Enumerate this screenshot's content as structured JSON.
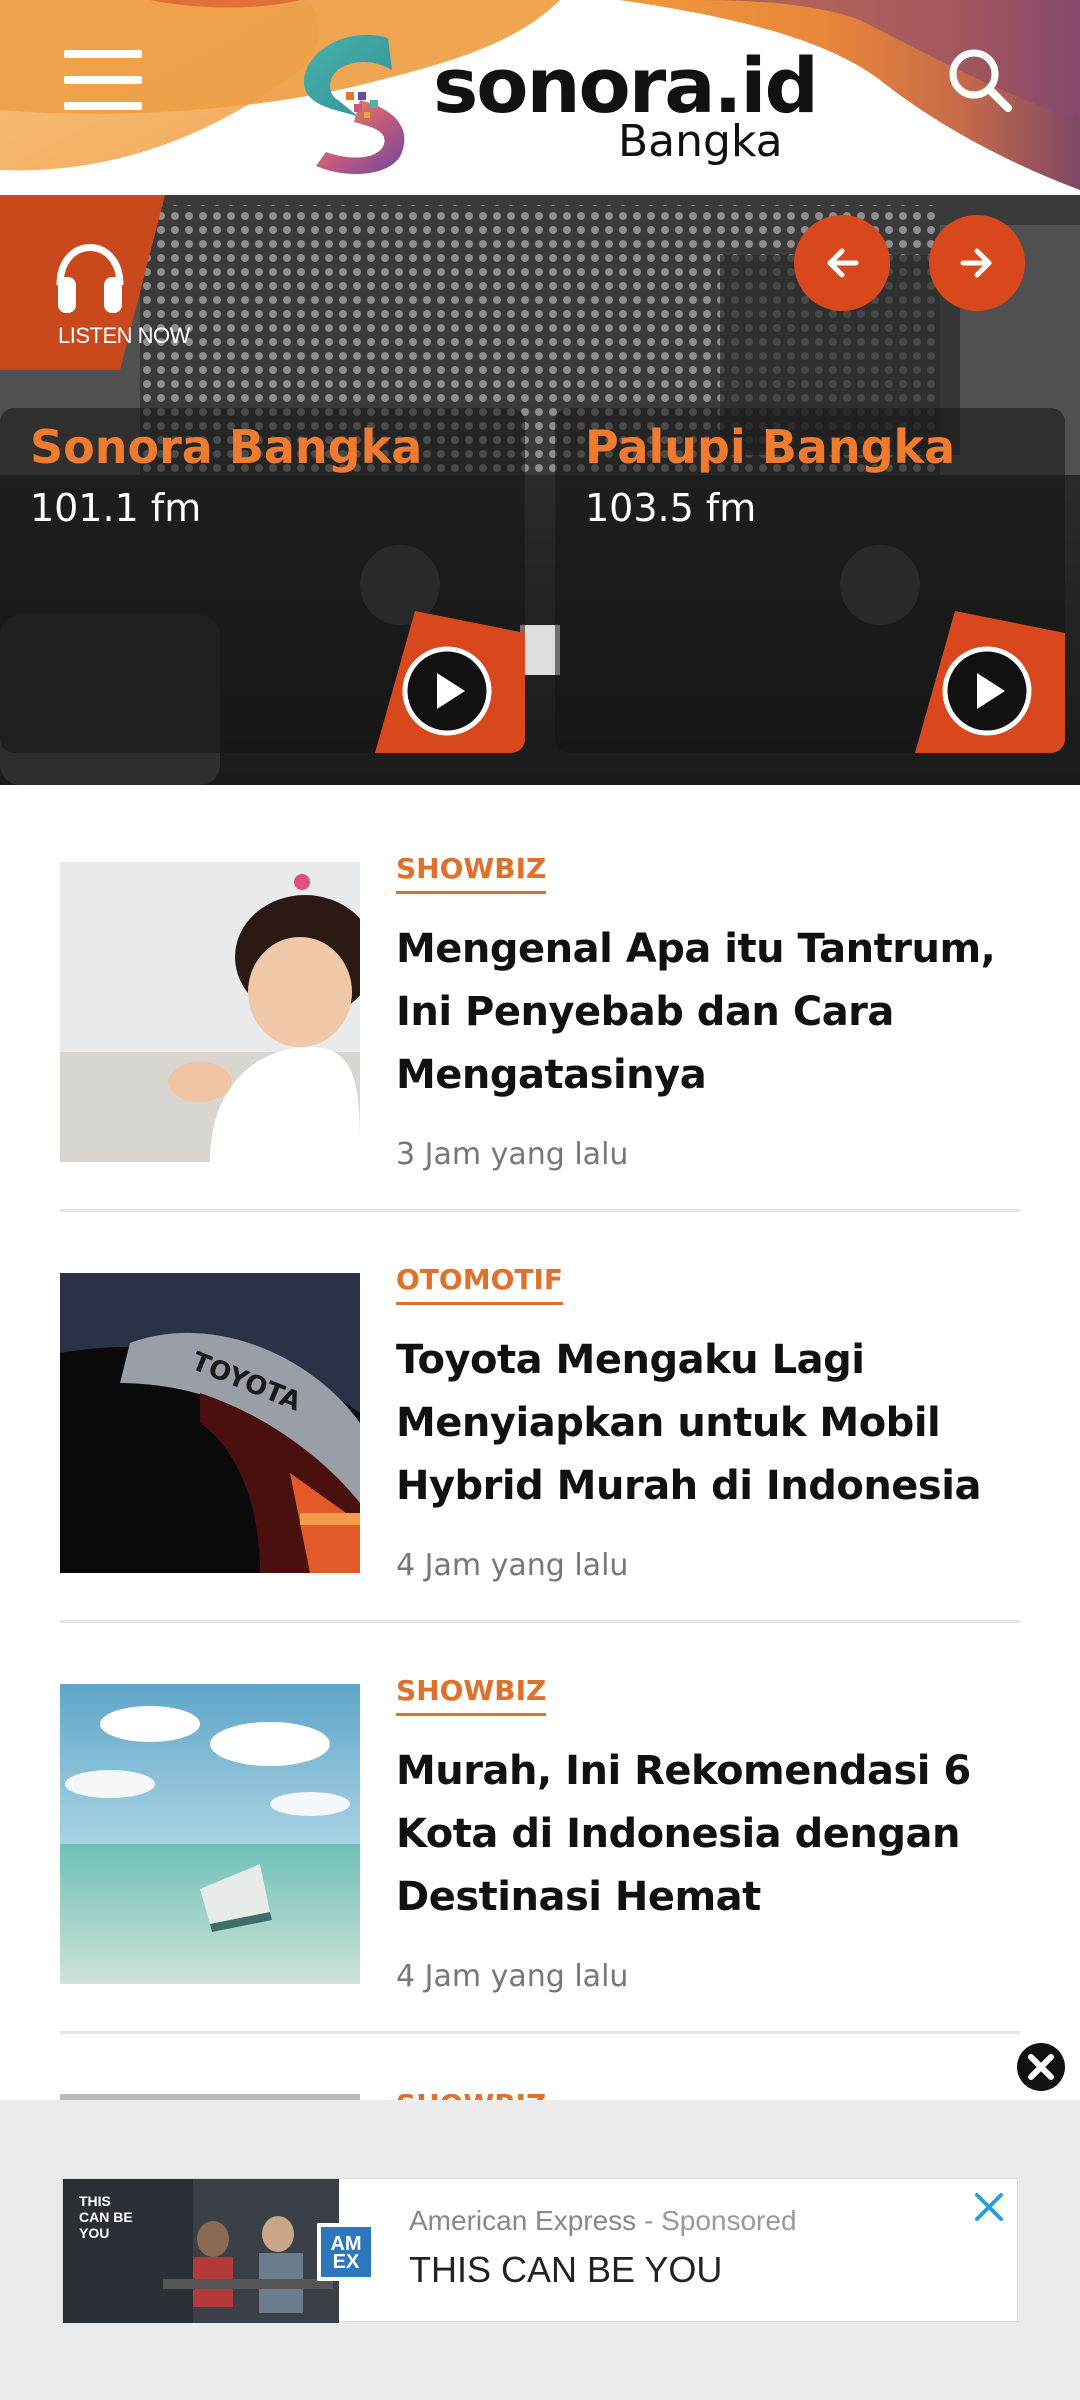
{
  "header": {
    "logo_text": "sonora.id",
    "logo_sub": "Bangka",
    "colors": {
      "orange": "#e8772e",
      "purple": "#8a4a6e",
      "red": "#d9481c"
    }
  },
  "hero": {
    "listen_label": "LISTEN NOW",
    "stations": [
      {
        "name": "Sonora Bangka",
        "frequency": "101.1 fm"
      },
      {
        "name": "Palupi Bangka",
        "frequency": "103.5 fm"
      }
    ]
  },
  "articles": [
    {
      "category": "SHOWBIZ",
      "title": "Mengenal Apa itu Tantrum, Ini Penyebab dan Cara Mengatasinya",
      "time": "3 Jam yang lalu"
    },
    {
      "category": "OTOMOTIF",
      "title": "Toyota Mengaku Lagi Menyiapkan untuk Mobil Hybrid Murah di Indonesia",
      "time": "4 Jam yang lalu"
    },
    {
      "category": "SHOWBIZ",
      "title": "Murah, Ini Rekomendasi 6 Kota di Indonesia dengan Destinasi Hemat",
      "time": "4 Jam yang lalu"
    }
  ],
  "next_article_peek": {
    "category": "SHOWBIZ"
  },
  "ad": {
    "advertiser": "American Express",
    "separator": " - ",
    "sponsored": "Sponsored",
    "headline": "THIS CAN BE YOU",
    "image_text": "THIS\nCAN BE\nYOU",
    "logo_text": "AM\nEX"
  }
}
